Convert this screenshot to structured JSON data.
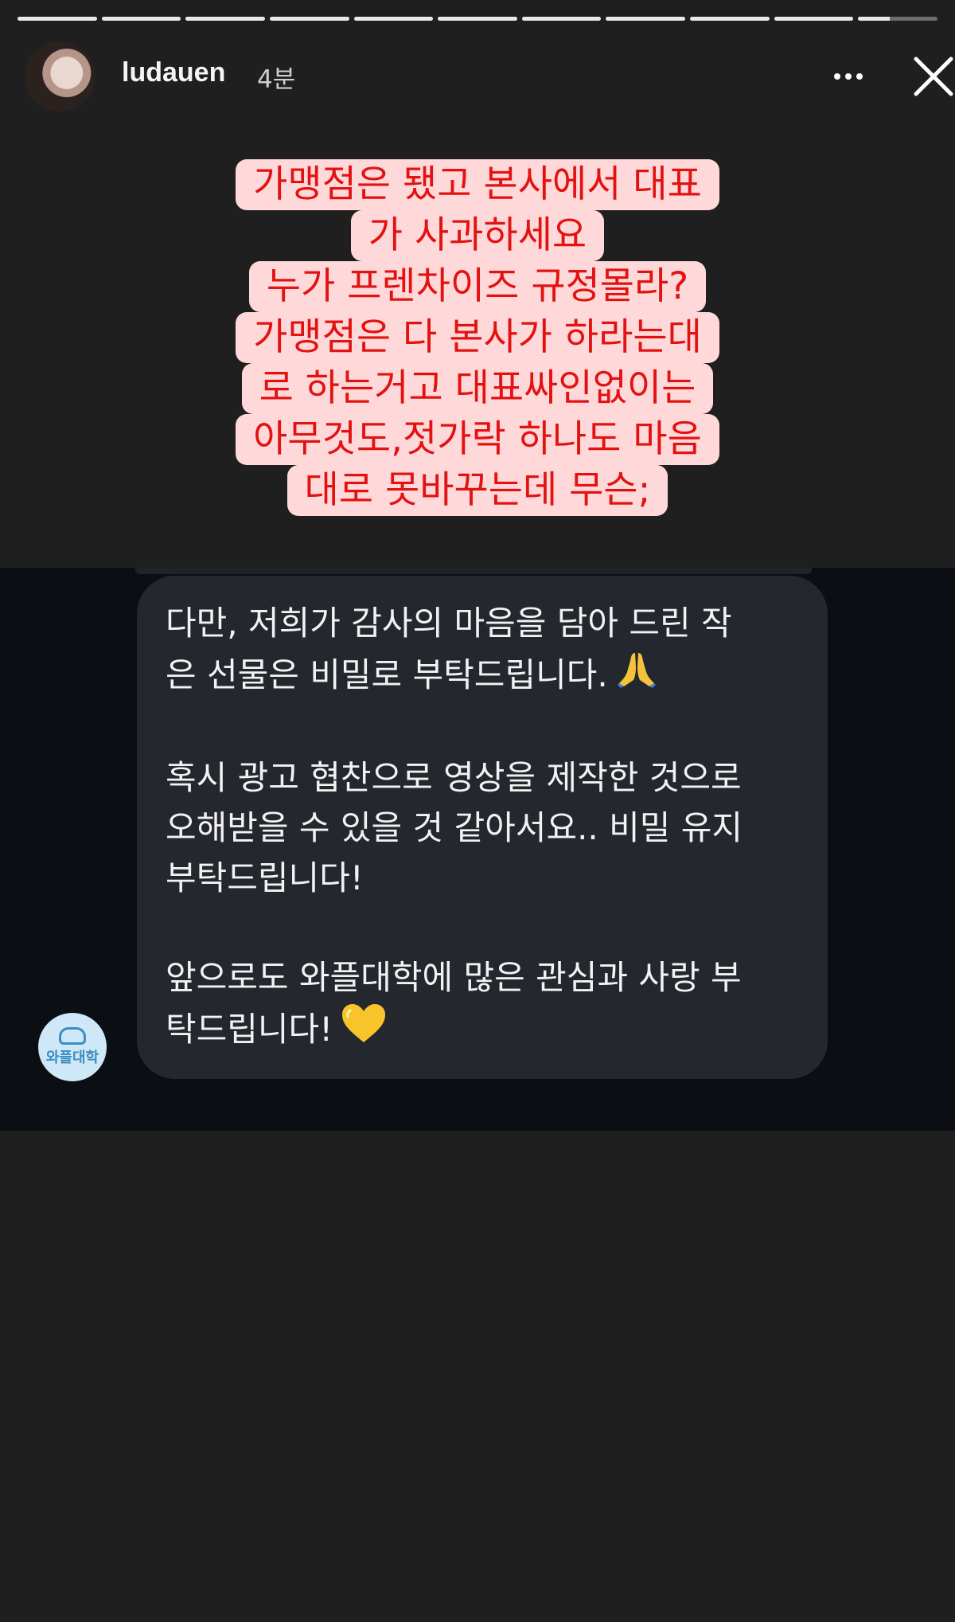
{
  "story": {
    "progress_segments": 11,
    "current_segment": 11,
    "current_segment_progress": 0.4,
    "username": "ludauen",
    "time": "4분"
  },
  "caption": {
    "lines": [
      "가맹점은 됐고 본사에서 대표",
      "가 사과하세요",
      "누가 프렌차이즈 규정몰라?",
      "가맹점은 다 본사가 하라는대",
      "로 하는거고 대표싸인없이는",
      "아무것도,젓가락 하나도 마음",
      "대로 못바꾸는데 무슨;"
    ],
    "text_color": "#e31212",
    "background_color": "#ffd9d9"
  },
  "dm": {
    "paragraph1": [
      "다만, 저희가 감사의 마음을 담아 드린 작",
      "은 선물은 비밀로 부탁드립니다."
    ],
    "paragraph2": [
      "혹시 광고 협찬으로 영상을 제작한 것으로",
      "오해받을 수 있을 것 같아서요.. 비밀 유지",
      "부탁드립니다!"
    ],
    "paragraph3": [
      "앞으로도 와플대학에 많은 관심과 사랑 부",
      "탁드립니다!"
    ],
    "emoji1": "praying-hands",
    "emoji2": "yellow-heart",
    "sender_logo_text": "와플대학",
    "bubble_color": "#24272d",
    "background_color": "#0b0e12"
  }
}
